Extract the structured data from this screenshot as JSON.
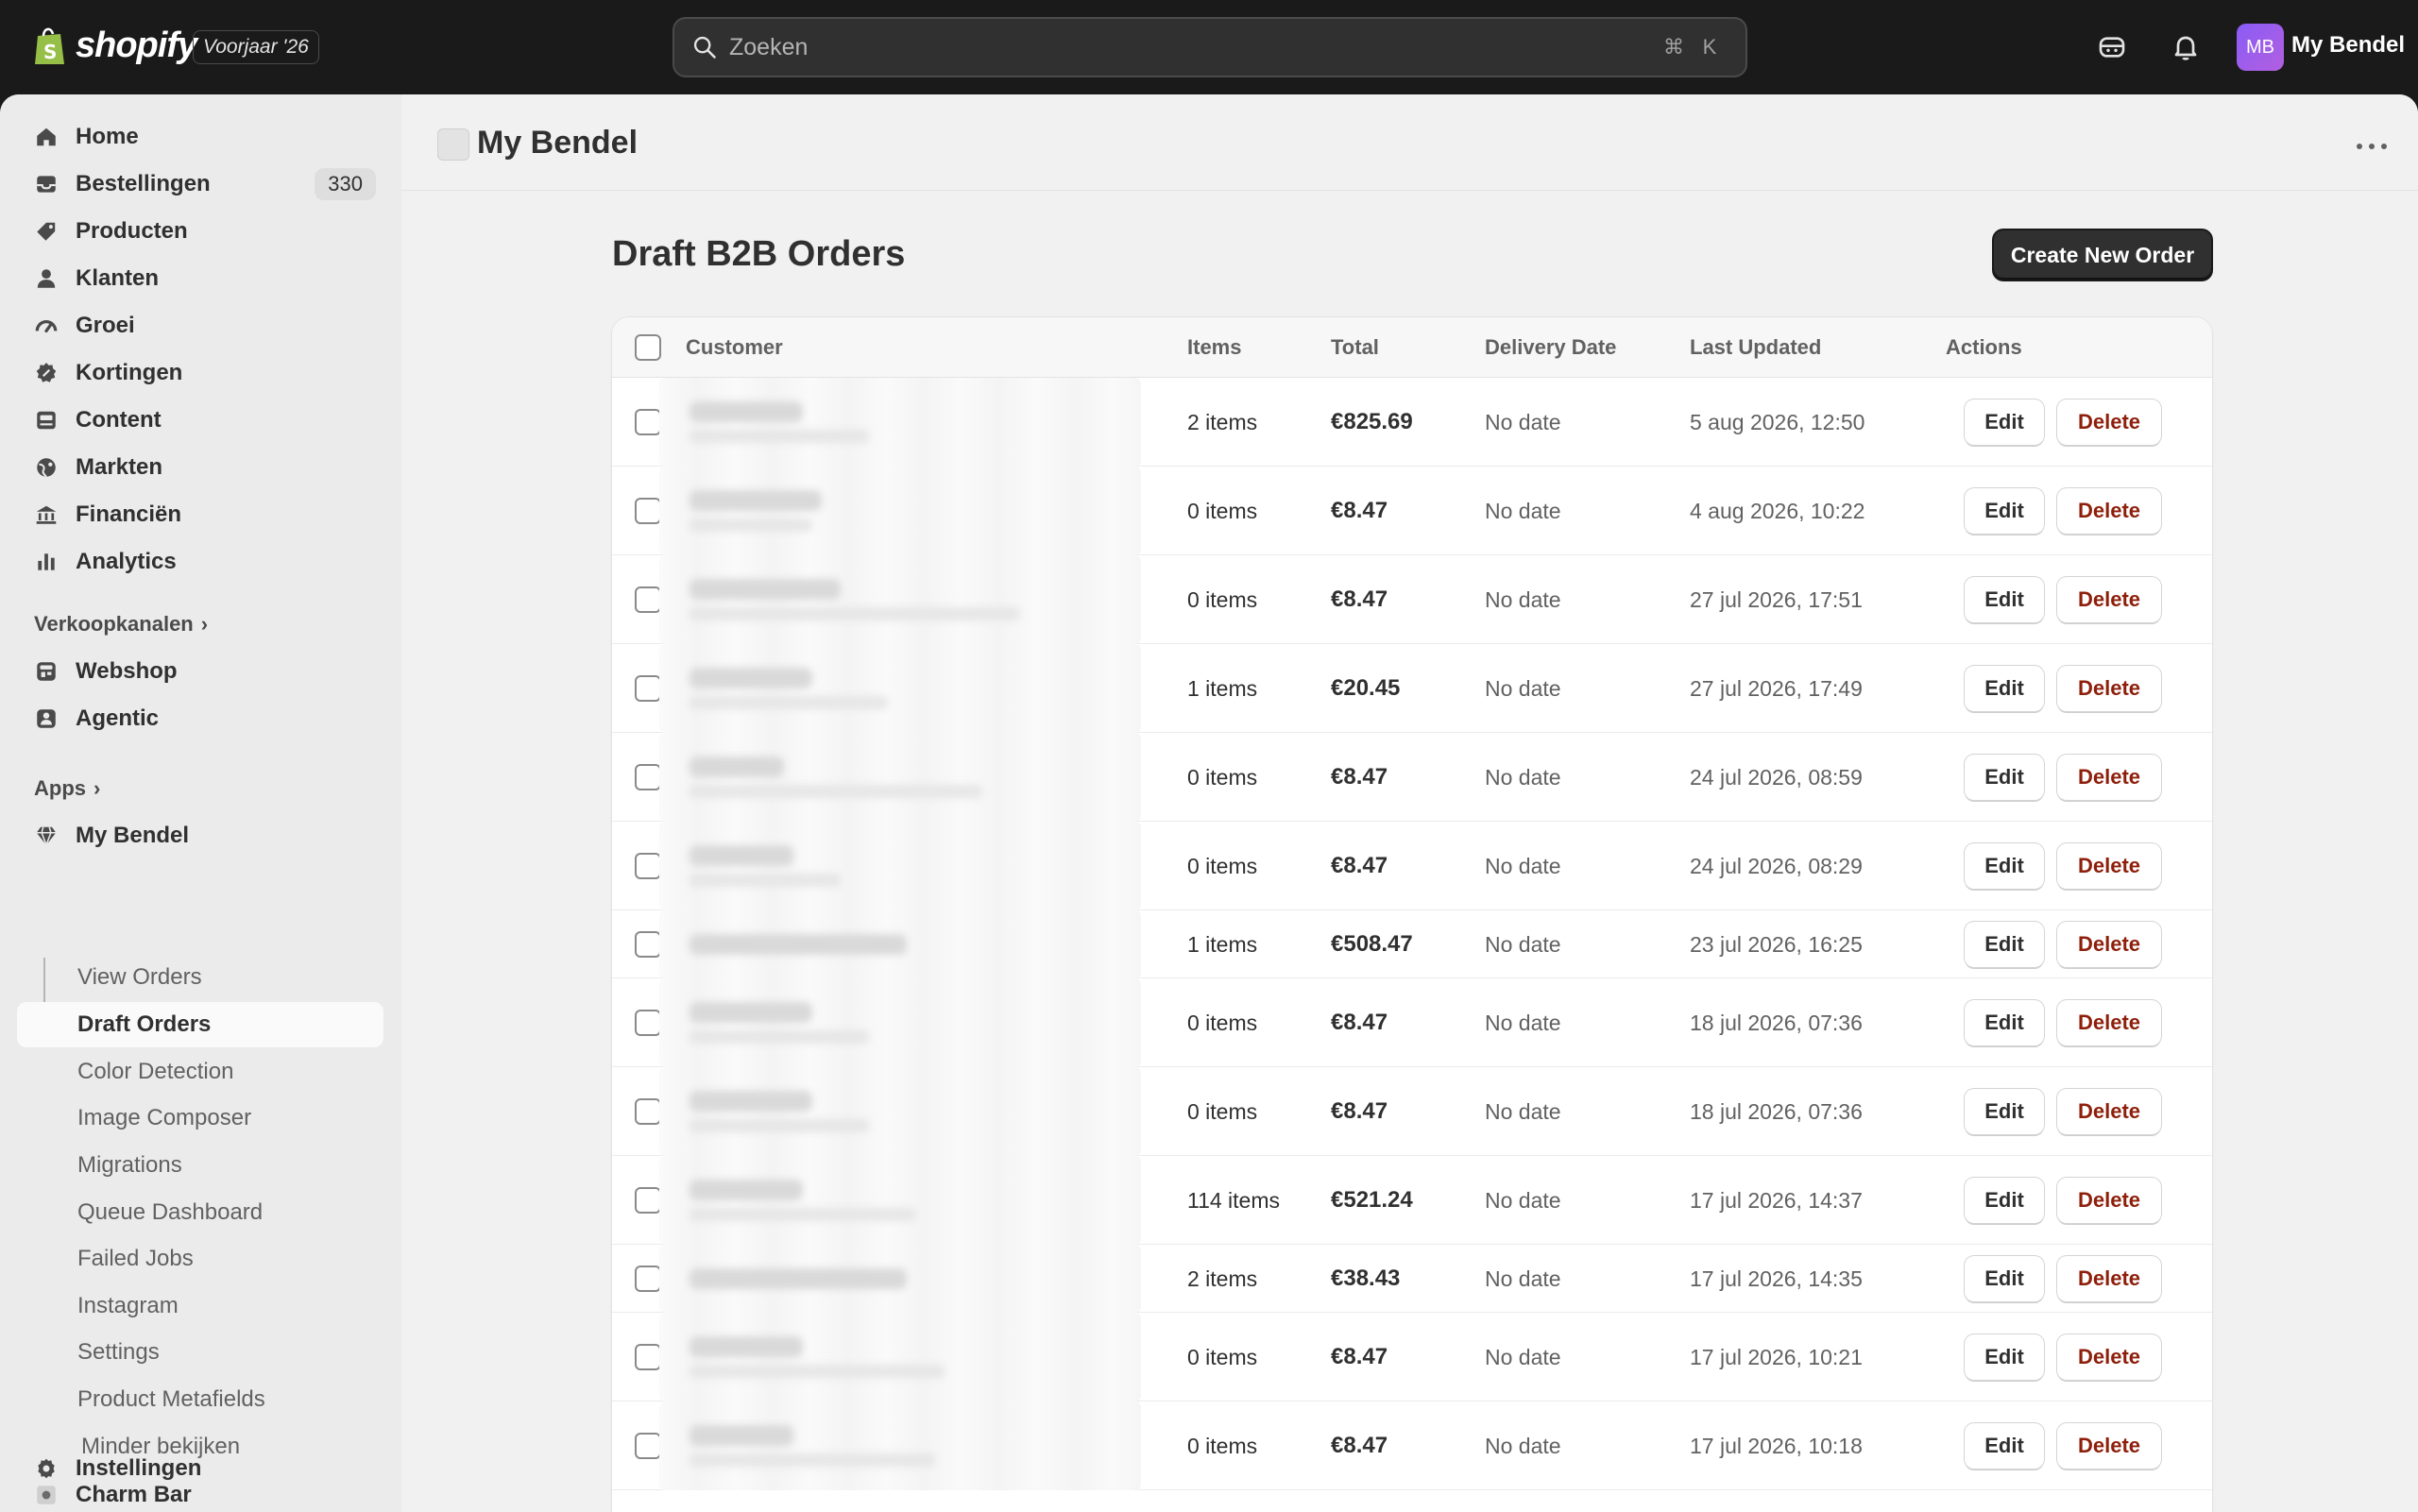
{
  "topbar": {
    "logo_text": "shopify",
    "edition": "Voorjaar '26",
    "search_placeholder": "Zoeken",
    "shortcut_cmd": "⌘",
    "shortcut_key": "K",
    "avatar_initials": "MB",
    "store_name": "My Bendel"
  },
  "sidebar": {
    "main_items": [
      {
        "label": "Home",
        "icon": "home-icon"
      },
      {
        "label": "Bestellingen",
        "icon": "inbox-icon",
        "badge": "330"
      },
      {
        "label": "Producten",
        "icon": "tag-icon"
      },
      {
        "label": "Klanten",
        "icon": "person-icon"
      },
      {
        "label": "Groei",
        "icon": "gauge-icon"
      },
      {
        "label": "Kortingen",
        "icon": "discount-icon"
      },
      {
        "label": "Content",
        "icon": "content-icon"
      },
      {
        "label": "Markten",
        "icon": "globe-icon"
      },
      {
        "label": "Financiën",
        "icon": "bank-icon"
      },
      {
        "label": "Analytics",
        "icon": "bar-chart-icon"
      }
    ],
    "sales_channels_label": "Verkoopkanalen",
    "channels": [
      {
        "label": "Webshop",
        "icon": "store-icon"
      },
      {
        "label": "Agentic",
        "icon": "agent-icon"
      }
    ],
    "apps_label": "Apps",
    "app_name": "My Bendel",
    "app_sub_items": [
      {
        "label": "View Orders"
      },
      {
        "label": "Draft Orders"
      },
      {
        "label": "Color Detection"
      },
      {
        "label": "Image Composer"
      },
      {
        "label": "Migrations"
      },
      {
        "label": "Queue Dashboard"
      },
      {
        "label": "Failed Jobs"
      },
      {
        "label": "Instagram"
      },
      {
        "label": "Settings"
      },
      {
        "label": "Product Metafields"
      },
      {
        "label": "Minder bekijken"
      }
    ],
    "charm_bar": "Charm Bar",
    "settings": "Instellingen"
  },
  "app_header": {
    "title": "My Bendel"
  },
  "page": {
    "title": "Draft B2B Orders",
    "create_button": "Create New Order"
  },
  "table": {
    "headers": {
      "customer": "Customer",
      "items": "Items",
      "total": "Total",
      "delivery_date": "Delivery Date",
      "last_updated": "Last Updated",
      "actions": "Actions"
    },
    "edit_label": "Edit",
    "delete_label": "Delete",
    "rows": [
      {
        "items": "2 items",
        "total": "€825.69",
        "delivery": "No date",
        "updated": "5 aug 2026, 12:50"
      },
      {
        "items": "0 items",
        "total": "€8.47",
        "delivery": "No date",
        "updated": "4 aug 2026, 10:22"
      },
      {
        "items": "0 items",
        "total": "€8.47",
        "delivery": "No date",
        "updated": "27 jul 2026, 17:51"
      },
      {
        "items": "1 items",
        "total": "€20.45",
        "delivery": "No date",
        "updated": "27 jul 2026, 17:49"
      },
      {
        "items": "0 items",
        "total": "€8.47",
        "delivery": "No date",
        "updated": "24 jul 2026, 08:59"
      },
      {
        "items": "0 items",
        "total": "€8.47",
        "delivery": "No date",
        "updated": "24 jul 2026, 08:29"
      },
      {
        "items": "1 items",
        "total": "€508.47",
        "delivery": "No date",
        "updated": "23 jul 2026, 16:25"
      },
      {
        "items": "0 items",
        "total": "€8.47",
        "delivery": "No date",
        "updated": "18 jul 2026, 07:36"
      },
      {
        "items": "0 items",
        "total": "€8.47",
        "delivery": "No date",
        "updated": "18 jul 2026, 07:36"
      },
      {
        "items": "114 items",
        "total": "€521.24",
        "delivery": "No date",
        "updated": "17 jul 2026, 14:37"
      },
      {
        "items": "2 items",
        "total": "€38.43",
        "delivery": "No date",
        "updated": "17 jul 2026, 14:35"
      },
      {
        "items": "0 items",
        "total": "€8.47",
        "delivery": "No date",
        "updated": "17 jul 2026, 10:21"
      },
      {
        "items": "0 items",
        "total": "€8.47",
        "delivery": "No date",
        "updated": "17 jul 2026, 10:18"
      }
    ]
  },
  "colors": {
    "topbar_bg": "#1a1a1a",
    "primary_button": "#303030",
    "delete_text": "#8e1f0b",
    "avatar": "#8a5cf6"
  }
}
